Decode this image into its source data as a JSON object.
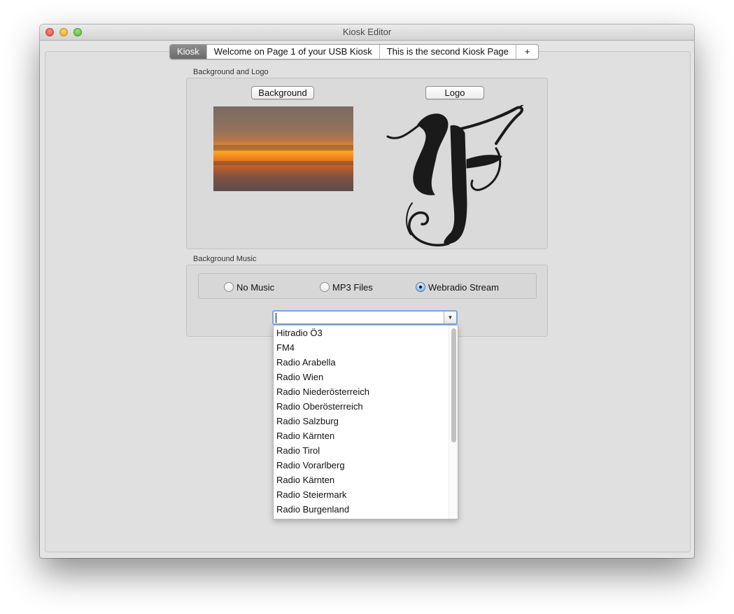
{
  "window": {
    "title": "Kiosk Editor"
  },
  "tabs": [
    "Kiosk",
    "Welcome on Page 1 of your USB Kiosk",
    "This is the second Kiosk Page",
    "+"
  ],
  "background_logo": {
    "group_label": "Background and Logo",
    "background_button": "Background",
    "logo_button": "Logo"
  },
  "music": {
    "group_label": "Background Music",
    "options": [
      {
        "label": "No Music",
        "selected": false
      },
      {
        "label": "MP3 Files",
        "selected": false
      },
      {
        "label": "Webradio Stream",
        "selected": true
      }
    ],
    "stream_input_value": "",
    "stations": [
      "Hitradio Ö3",
      "FM4",
      "Radio Arabella",
      "Radio Wien",
      "Radio Niederösterreich",
      "Radio Oberösterreich",
      "Radio Salzburg",
      "Radio Kärnten",
      "Radio Tirol",
      "Radio Vorarlberg",
      "Radio Kärnten",
      "Radio Steiermark",
      "Radio Burgenland"
    ]
  },
  "icons": {
    "close": "close-icon",
    "minimize": "minimize-icon",
    "zoom": "zoom-icon",
    "dropdown_arrow": "chevron-down-icon"
  }
}
